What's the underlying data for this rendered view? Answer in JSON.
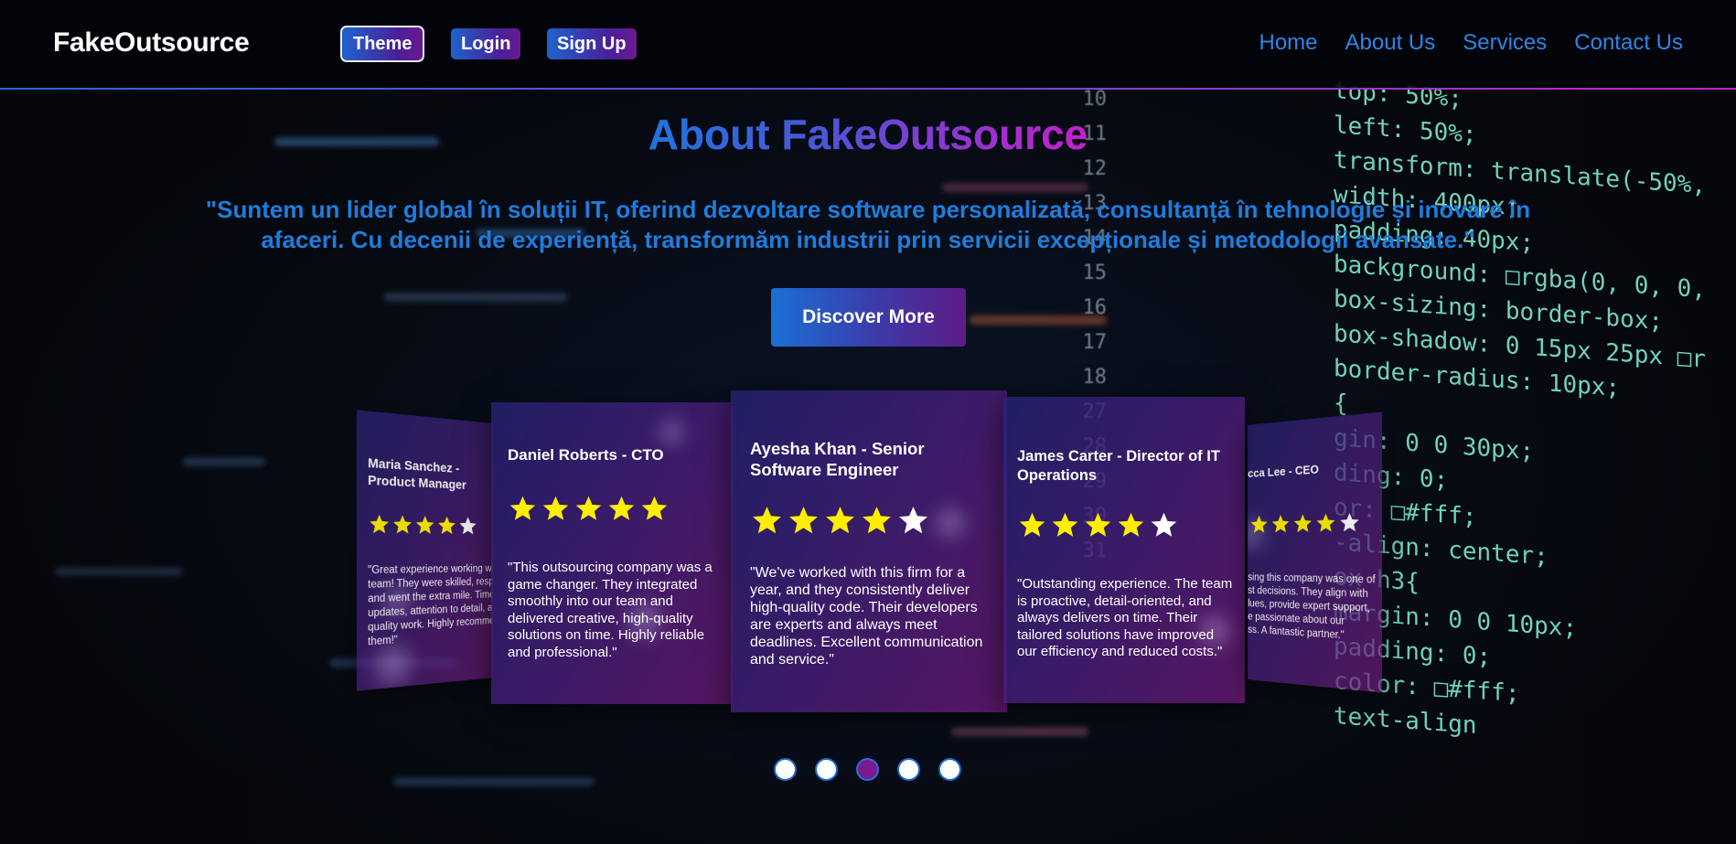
{
  "brand": "FakeOutsource",
  "nav_buttons": {
    "theme": "Theme",
    "login": "Login",
    "signup": "Sign Up"
  },
  "nav_links": [
    "Home",
    "About Us",
    "Services",
    "Contact Us"
  ],
  "hero": {
    "title": "About FakeOutsource",
    "quote": "\"Suntem un lider global în soluții IT, oferind dezvoltare software personalizată, consultanță în tehnologie și inovare în afaceri. Cu decenii de experiență, transformăm industrii prin servicii excepționale și metodologii avansate.\"",
    "cta": "Discover More"
  },
  "testimonials": [
    {
      "name": "Maria Sanchez - Product Manager",
      "rating": 4,
      "text": "\"Great experience working with\nteam! They were skilled, respo\nand went the extra mile. Timel\nupdates, attention to detail, an\nquality work. Highly recommen\nthem!\""
    },
    {
      "name": "Daniel Roberts - CTO",
      "rating": 5,
      "text": "\"This outsourcing company was a game changer. They integrated smoothly into our team and delivered creative, high-quality solutions on time. Highly reliable and professional.\""
    },
    {
      "name": "Ayesha Khan - Senior Software Engineer",
      "rating": 4,
      "text": "\"We've worked with this firm for a year, and they consistently deliver high-quality code. Their developers are experts and always meet deadlines. Excellent communication and service.\""
    },
    {
      "name": "James Carter - Director of IT Operations",
      "rating": 4,
      "text": "\"Outstanding experience. The team is proactive, detail-oriented, and always delivers on time. Their tailored solutions have improved our efficiency and reduced costs.\""
    },
    {
      "name": "cca Lee - CEO",
      "rating": 4,
      "text": "sing this company was one of\nst decisions. They align with\nlues, provide expert support,\ne passionate about our\nss. A fantastic partner.\""
    }
  ],
  "carousel": {
    "count": 5,
    "active": 2
  },
  "colors": {
    "accent_blue": "#1e7ddd",
    "accent_purple": "#7b1a8c",
    "star_filled": "#ffee00",
    "star_empty": "#ffffff"
  },
  "background_code": {
    "line_numbers": [
      "10",
      "11",
      "12",
      "13",
      "14",
      "15",
      "16",
      "17",
      "18",
      "27",
      "28",
      "29",
      "30",
      "31"
    ],
    "lines": [
      "top: 50%;",
      "left: 50%;",
      "transform: translate(-50%,",
      "width: 400px;",
      "padding: 40px;",
      "background: □rgba(0, 0, 0,",
      "box-sizing: border-box;",
      "box-shadow: 0 15px 25px □r",
      "border-radius: 10px;",
      "{",
      "gin: 0 0 30px;",
      "ding: 0;",
      "or: □#fff;",
      "-align: center;",
      "ox h3{",
      "margin: 0 0 10px;",
      "padding: 0;",
      "color: □#fff;",
      "text-align"
    ]
  }
}
